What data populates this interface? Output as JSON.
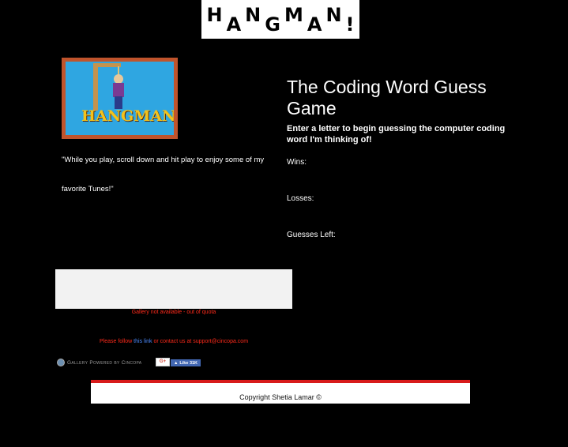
{
  "header": {
    "logo_letters": [
      "H",
      "A",
      "N",
      "G",
      "M",
      "A",
      "N",
      "!"
    ]
  },
  "left": {
    "image_title": "HANGMAN",
    "quote": "\"While you play, scroll down and hit play to enjoy some of my favorite Tunes!\""
  },
  "game": {
    "title": "The Coding Word Guess Game",
    "instructions": "Enter a letter to begin guessing the computer coding word I'm thinking of!",
    "wins_label": "Wins:",
    "losses_label": "Losses:",
    "guesses_label": "Guesses Left:"
  },
  "gallery": {
    "error": "Gallery not available - out of quota",
    "follow_prefix": "Please follow",
    "follow_link": "this link",
    "follow_suffix": "or contact us at support@cincopa.com",
    "powered_by": "Gallery Powered by Cincopa",
    "gplus_label": "G+",
    "fb_like_label": "Like 31K"
  },
  "footer": {
    "copyright": "Copyright Shetia Lamar ©"
  },
  "colors": {
    "background": "#000000",
    "error_text": "#ff2a1a",
    "footer_accent": "#d81b1b",
    "facebook": "#4267b2"
  }
}
